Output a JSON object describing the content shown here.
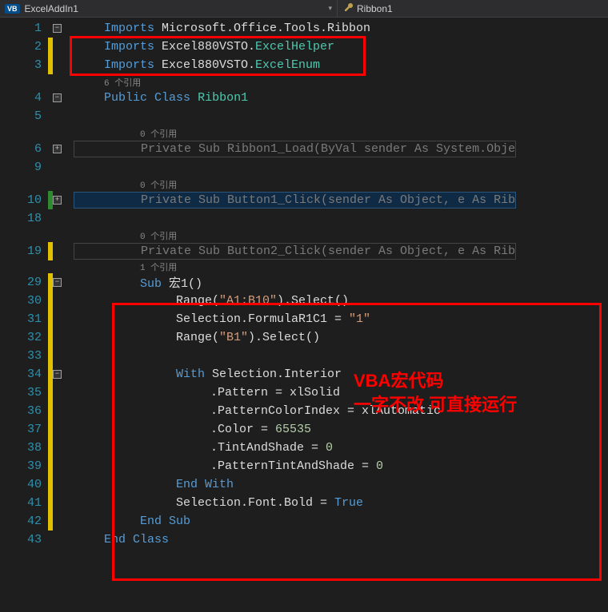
{
  "tabs": {
    "left": "ExcelAddIn1",
    "right": "Ribbon1",
    "vb_badge": "VB"
  },
  "ref_label": "个引用",
  "annotation": {
    "line1": "VBA宏代码",
    "line2": "一字不改 可直接运行"
  },
  "lines": [
    {
      "n": "1",
      "fold": "-",
      "code": [
        [
          "kw",
          "Imports"
        ],
        [
          "",
          " Microsoft.Office.Tools.Ribbon"
        ]
      ]
    },
    {
      "n": "2",
      "bar": "y",
      "code": [
        [
          "kw",
          "Imports"
        ],
        [
          "",
          " Excel880VSTO."
        ],
        [
          "cls",
          "ExcelHelper"
        ]
      ]
    },
    {
      "n": "3",
      "bar": "y",
      "code": [
        [
          "kw",
          "Imports"
        ],
        [
          "",
          " Excel880VSTO."
        ],
        [
          "cls",
          "ExcelEnum"
        ]
      ]
    },
    {
      "refcount": "6",
      "pad_ref": 130
    },
    {
      "n": "4",
      "fold": "-",
      "code": [
        [
          "kw",
          "Public"
        ],
        [
          "",
          " "
        ],
        [
          "kw",
          "Class"
        ],
        [
          "",
          " "
        ],
        [
          "cls",
          "Ribbon1"
        ]
      ]
    },
    {
      "n": "5",
      "code": []
    },
    {
      "refcount": "0",
      "pad_ref": 175
    },
    {
      "n": "6",
      "fold": "+",
      "bar": "",
      "dim": true,
      "code": [
        [
          "dim-txt",
          "Private Sub Ribbon1_Load(ByVal sender As System.Obje"
        ]
      ],
      "pad": 175
    },
    {
      "n": "9",
      "code": []
    },
    {
      "refcount": "0",
      "pad_ref": 175
    },
    {
      "n": "10",
      "fold": "+",
      "bar": "g",
      "dim": true,
      "code": [
        [
          "dim-txt",
          "Private Sub Button1_Click(sender As Object, e As Rib"
        ]
      ],
      "pad": 175,
      "hlbox": true
    },
    {
      "n": "18",
      "code": []
    },
    {
      "refcount": "0",
      "pad_ref": 175
    },
    {
      "n": "19",
      "bar": "y",
      "dim": true,
      "code": [
        [
          "dim-txt",
          "Private Sub Button2_Click(sender As Object, e As Rib"
        ]
      ],
      "pad": 175
    },
    {
      "refcount": "1",
      "pad_ref": 175,
      "short": true
    },
    {
      "n": "29",
      "bar": "y",
      "fold": "-",
      "code": [
        [
          "kw",
          "Sub"
        ],
        [
          "",
          " 宏1()"
        ]
      ],
      "pad": 175
    },
    {
      "n": "30",
      "bar": "y",
      "code": [
        [
          "",
          "Range("
        ],
        [
          "str",
          "\"A1:B10\""
        ],
        [
          "",
          ").Select()"
        ]
      ],
      "pad": 220
    },
    {
      "n": "31",
      "bar": "y",
      "code": [
        [
          "",
          "Selection.FormulaR1C1 = "
        ],
        [
          "str",
          "\"1\""
        ]
      ],
      "pad": 220
    },
    {
      "n": "32",
      "bar": "y",
      "code": [
        [
          "",
          "Range("
        ],
        [
          "str",
          "\"B1\""
        ],
        [
          "",
          ").Select()"
        ]
      ],
      "pad": 220
    },
    {
      "n": "33",
      "bar": "y",
      "code": [],
      "pad": 220
    },
    {
      "n": "34",
      "bar": "y",
      "fold": "-",
      "code": [
        [
          "kw",
          "With"
        ],
        [
          "",
          " Selection.Interior"
        ]
      ],
      "pad": 220
    },
    {
      "n": "35",
      "bar": "y",
      "code": [
        [
          "",
          ".Pattern = xlSolid"
        ]
      ],
      "pad": 263
    },
    {
      "n": "36",
      "bar": "y",
      "code": [
        [
          "",
          ".PatternColorIndex = xlAutomatic"
        ]
      ],
      "pad": 263
    },
    {
      "n": "37",
      "bar": "y",
      "code": [
        [
          "",
          ".Color = "
        ],
        [
          "num",
          "65535"
        ]
      ],
      "pad": 263
    },
    {
      "n": "38",
      "bar": "y",
      "code": [
        [
          "",
          ".TintAndShade = "
        ],
        [
          "num",
          "0"
        ]
      ],
      "pad": 263
    },
    {
      "n": "39",
      "bar": "y",
      "code": [
        [
          "",
          ".PatternTintAndShade = "
        ],
        [
          "num",
          "0"
        ]
      ],
      "pad": 263
    },
    {
      "n": "40",
      "bar": "y",
      "code": [
        [
          "kw",
          "End"
        ],
        [
          "",
          " "
        ],
        [
          "kw",
          "With"
        ]
      ],
      "pad": 220
    },
    {
      "n": "41",
      "bar": "y",
      "code": [
        [
          "",
          "Selection.Font.Bold = "
        ],
        [
          "kw",
          "True"
        ]
      ],
      "pad": 220
    },
    {
      "n": "42",
      "bar": "y",
      "code": [
        [
          "kw",
          "End"
        ],
        [
          "",
          " "
        ],
        [
          "kw",
          "Sub"
        ]
      ],
      "pad": 175
    },
    {
      "n": "43",
      "code": [
        [
          "kw",
          "End"
        ],
        [
          "",
          " "
        ],
        [
          "kw",
          "Class"
        ]
      ],
      "pad": 130
    }
  ]
}
